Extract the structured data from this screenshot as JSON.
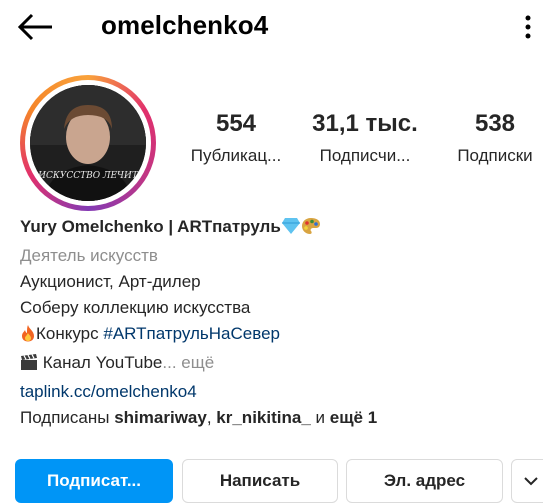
{
  "header": {
    "username": "omelchenko4",
    "back_icon": "arrow-left-icon",
    "menu_icon": "more-vertical-icon"
  },
  "profile": {
    "avatar_caption": "ИСКУССТВО ЛЕЧИТ",
    "stats": [
      {
        "value": "554",
        "label": "Публикац..."
      },
      {
        "value": "31,1 тыс.",
        "label": "Подписчи..."
      },
      {
        "value": "538",
        "label": "Подписки"
      }
    ]
  },
  "bio": {
    "name": "Yury Omelchenko | ARTпатруль",
    "category": "Деятель искусств",
    "line1": "Аукционист, Арт-дилер",
    "line2": "Соберу коллекцию искусства",
    "contest_prefix": "Конкурс ",
    "contest_hashtag": "#ARTпатрульНаСевер",
    "youtube_text": "Канал YouTube",
    "ellipsis": "...",
    "more": "ещё",
    "link": "taplink.cc/omelchenko4",
    "followed_prefix": "Подписаны ",
    "follower1": "shimariway",
    "sep": ", ",
    "follower2": "kr_nikitina_",
    "and": " и ",
    "more_followers": "ещё 1"
  },
  "actions": {
    "follow": "Подписат...",
    "message": "Написать",
    "email": "Эл. адрес",
    "expand_icon": "chevron-down-icon"
  },
  "colors": {
    "accent": "#0095f6",
    "link": "#00376b",
    "secondary_text": "#8e8e8e",
    "border": "#dbdbdb"
  }
}
